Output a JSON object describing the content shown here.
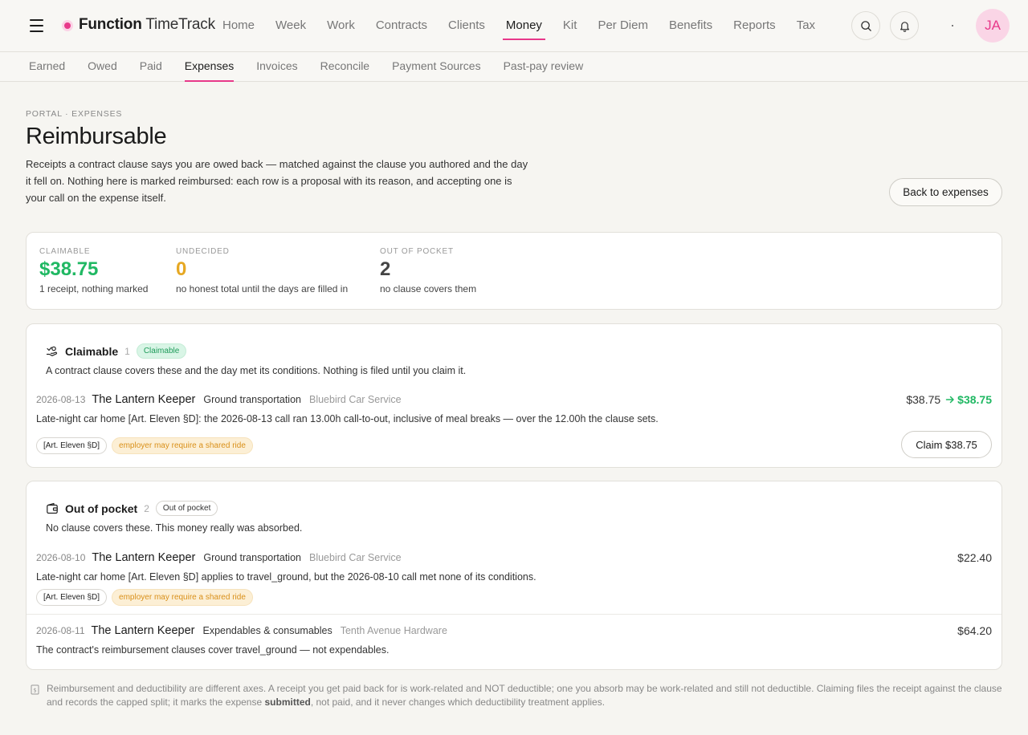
{
  "app": {
    "brand_bold": "Function",
    "brand_light": "TimeTrack",
    "avatar_initials": "JA",
    "accent_color": "#e8388a"
  },
  "nav": {
    "items": [
      "Home",
      "Week",
      "Work",
      "Contracts",
      "Clients",
      "Money",
      "Kit",
      "Per Diem",
      "Benefits",
      "Reports",
      "Tax"
    ],
    "active": "Money"
  },
  "subnav": {
    "items": [
      "Earned",
      "Owed",
      "Paid",
      "Expenses",
      "Invoices",
      "Reconcile",
      "Payment Sources",
      "Past-pay review"
    ],
    "active": "Expenses"
  },
  "header": {
    "breadcrumb": "PORTAL · EXPENSES",
    "title": "Reimbursable",
    "intro": "Receipts a contract clause says you are owed back — matched against the clause you authored and the day it fell on. Nothing here is marked reimbursed: each row is a proposal with its reason, and accepting one is your call on the expense itself.",
    "back_label": "Back to expenses"
  },
  "stats": [
    {
      "label": "CLAIMABLE",
      "value": "$38.75",
      "note": "1 receipt, nothing marked",
      "color": "#20b863"
    },
    {
      "label": "UNDECIDED",
      "value": "0",
      "note": "no honest total until the days are filled in",
      "color": "#e6a823"
    },
    {
      "label": "OUT OF POCKET",
      "value": "2",
      "note": "no clause covers them",
      "color": "#444444"
    }
  ],
  "claimable": {
    "title": "Claimable",
    "count": "1",
    "badge": "Claimable",
    "description": "A contract clause covers these and the day met its conditions. Nothing is filed until you claim it.",
    "rows": [
      {
        "date": "2026-08-13",
        "title": "The Lantern Keeper",
        "category": "Ground transportation",
        "vendor": "Bluebird Car Service",
        "amount": "$38.75",
        "claim_amount": "$38.75",
        "reason": "Late-night car home [Art. Eleven §D]: the 2026-08-13 call ran 13.00h call-to-out, inclusive of meal breaks — over the 12.00h the clause sets.",
        "tags": [
          "[Art. Eleven §D]",
          "employer may require a shared ride"
        ],
        "claim_label": "Claim $38.75"
      }
    ]
  },
  "out_of_pocket": {
    "title": "Out of pocket",
    "count": "2",
    "badge": "Out of pocket",
    "description": "No clause covers these. This money really was absorbed.",
    "rows": [
      {
        "date": "2026-08-10",
        "title": "The Lantern Keeper",
        "category": "Ground transportation",
        "vendor": "Bluebird Car Service",
        "amount": "$22.40",
        "reason": "Late-night car home [Art. Eleven §D] applies to travel_ground, but the 2026-08-10 call met none of its conditions.",
        "tags": [
          "[Art. Eleven §D]",
          "employer may require a shared ride"
        ]
      },
      {
        "date": "2026-08-11",
        "title": "The Lantern Keeper",
        "category": "Expendables & consumables",
        "vendor": "Tenth Avenue Hardware",
        "amount": "$64.20",
        "reason": "The contract's reimbursement clauses cover travel_ground — not expendables."
      }
    ]
  },
  "footnote": {
    "text_before": "Reimbursement and deductibility are different axes. A receipt you get paid back for is work-related and NOT deductible; one you absorb may be work-related and still not deductible. Claiming files the receipt against the clause and records the capped split; it marks the expense ",
    "bold": "submitted",
    "text_after": ", not paid, and it never changes which deductibility treatment applies."
  }
}
